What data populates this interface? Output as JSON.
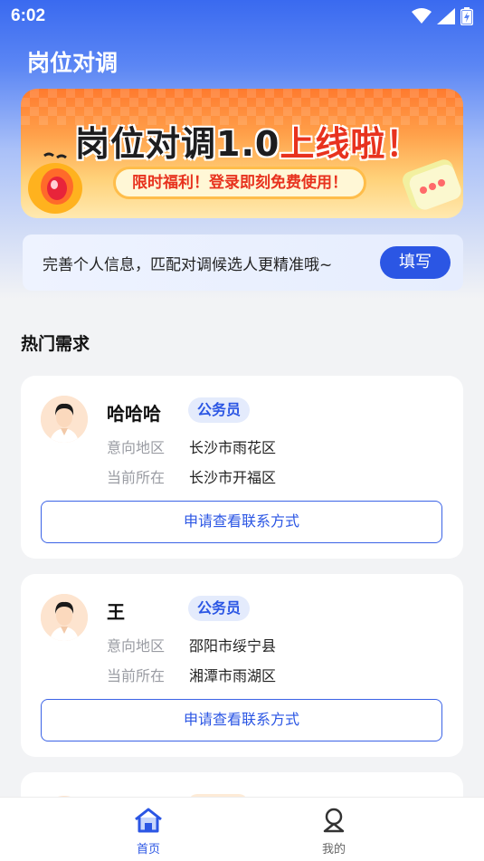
{
  "status_bar": {
    "time": "6:02"
  },
  "header": {
    "title": "岗位对调"
  },
  "banner": {
    "headline_dark": "岗位对调1.0",
    "headline_red": "上线啦！",
    "subtitle": "限时福利！登录即刻免费使用！"
  },
  "info_bar": {
    "text": "完善个人信息，匹配对调候选人更精准哦~",
    "button_label": "填写"
  },
  "section": {
    "title": "热门需求"
  },
  "cards": [
    {
      "name": "哈哈哈",
      "tag": "公务员",
      "intent_label": "意向地区",
      "intent_value": "长沙市雨花区",
      "current_label": "当前所在",
      "current_value": "长沙市开福区",
      "button_label": "申请查看联系方式"
    },
    {
      "name": "王",
      "tag": "公务员",
      "intent_label": "意向地区",
      "intent_value": "邵阳市绥宁县",
      "current_label": "当前所在",
      "current_value": "湘潭市雨湖区",
      "button_label": "申请查看联系方式"
    }
  ],
  "bottom_nav": {
    "home_label": "首页",
    "mine_label": "我的",
    "active_color": "#2b56e4",
    "inactive_color": "#666666"
  },
  "colors": {
    "accent": "#2b56e4"
  }
}
